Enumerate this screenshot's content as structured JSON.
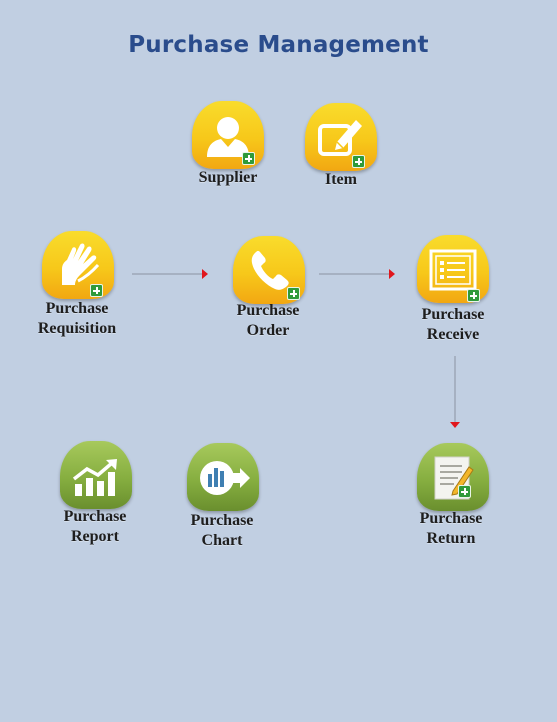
{
  "page": {
    "title": "Purchase Management"
  },
  "colors": {
    "background": "#c1cfe2",
    "title": "#2a4c8c",
    "icon_yellow": "#f7c81a",
    "icon_green": "#86ae40",
    "plus_badge": "#2f9a3a",
    "arrow_head": "#e0161c"
  },
  "modules": {
    "supplier": {
      "label": "Supplier",
      "icon": "person-icon",
      "has_add": true
    },
    "item": {
      "label": "Item",
      "icon": "edit-icon",
      "has_add": true
    },
    "purchase_requisition": {
      "line1": "Purchase",
      "line2": "Requisition",
      "icon": "hand-icon",
      "has_add": true
    },
    "purchase_order": {
      "line1": "Purchase",
      "line2": "Order",
      "icon": "phone-icon",
      "has_add": true
    },
    "purchase_receive": {
      "line1": "Purchase",
      "line2": "Receive",
      "icon": "form-icon",
      "has_add": true
    },
    "purchase_report": {
      "line1": "Purchase",
      "line2": "Report",
      "icon": "trend-chart-icon",
      "has_add": false
    },
    "purchase_chart": {
      "line1": "Purchase",
      "line2": "Chart",
      "icon": "bar-chart-arrow-icon",
      "has_add": false
    },
    "purchase_return": {
      "line1": "Purchase",
      "line2": "Return",
      "icon": "document-pencil-icon",
      "has_add": true
    }
  }
}
